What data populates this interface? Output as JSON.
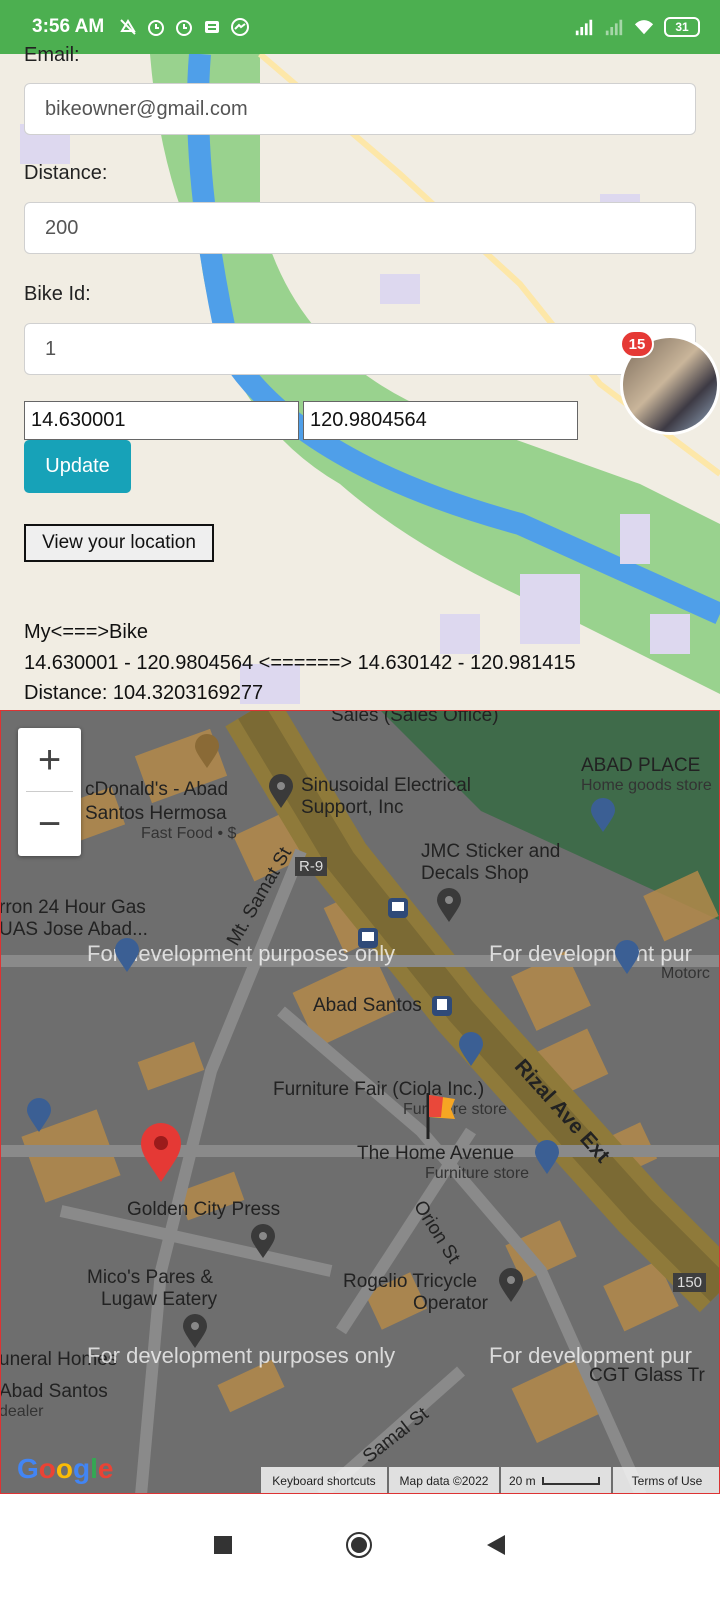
{
  "status_bar": {
    "time": "3:56 AM",
    "battery": "31",
    "icons": [
      "do-not-disturb-icon",
      "alarm-icon",
      "alarm-icon",
      "news-icon",
      "messenger-icon",
      "signal-icon",
      "signal-weak-icon",
      "wifi-icon",
      "battery-icon"
    ]
  },
  "form": {
    "email_label": "Email:",
    "email_value": "bikeowner@gmail.com",
    "distance_label": "Distance:",
    "distance_value": "200",
    "bike_id_label": "Bike Id:",
    "bike_id_value": "1",
    "latitude_value": "14.630001",
    "longitude_value": "120.9804564",
    "update_label": "Update",
    "view_location_label": "View your location"
  },
  "info": {
    "heading": "My<===>Bike",
    "coords_line": "14.630001 - 120.9804564 <======> 14.630142 - 120.981415",
    "distance_line": "Distance: 104.3203169277"
  },
  "chat_head": {
    "badge": "15"
  },
  "map": {
    "zoom_in": "+",
    "zoom_out": "−",
    "watermark": "For development purposes only",
    "watermark_clipped_right": "For development pur",
    "pois": {
      "sales_office": "Sales (Sales Office)",
      "mcdonalds_1": "cDonald's - Abad",
      "mcdonalds_2": "Santos Hermosa",
      "mcdonalds_sub": "Fast Food • $",
      "sinusoidal_1": "Sinusoidal Electrical",
      "sinusoidal_2": "Support, Inc",
      "abad_place": "ABAD PLACE",
      "abad_place_sub": "Home goods store",
      "jmc_1": "JMC Sticker and",
      "jmc_2": "Decals Shop",
      "gas_1": "rron 24 Hour Gas",
      "gas_2": "UAS Jose Abad...",
      "motorc": "Motorc",
      "abad_santos": "Abad Santos",
      "furniture_fair": "Furniture Fair (Ciola Inc.)",
      "furniture_fair_sub": "Furniture store",
      "home_avenue": "The Home Avenue",
      "home_avenue_sub": "Furniture store",
      "golden_city": "Golden City Press",
      "micos_1": "Mico's Pares &",
      "micos_2": "Lugaw Eatery",
      "rogelio_1": "Rogelio Tricycle",
      "rogelio_2": "Operator",
      "funeral": "uneral Homes",
      "abad_santos_2": "Abad Santos",
      "dealer": "dealer",
      "cgt": "CGT Glass Tr"
    },
    "streets": {
      "mt_samat": "Mt. Samat St",
      "rizal": "Rizal Ave Ext",
      "orion": "Orion St",
      "samal": "Samal St",
      "r9": "R-9",
      "n150": "150"
    },
    "footer": {
      "shortcuts": "Keyboard shortcuts",
      "map_data": "Map data ©2022",
      "scale": "20 m",
      "terms": "Terms of Use"
    },
    "logo": "Google"
  },
  "nav": {
    "icons": [
      "recents-square-icon",
      "home-circle-icon",
      "back-triangle-icon"
    ]
  },
  "colors": {
    "status_bar": "#4caf50",
    "update_button": "#17a2b8",
    "marker": "#e53935",
    "badge": "#e53935"
  }
}
